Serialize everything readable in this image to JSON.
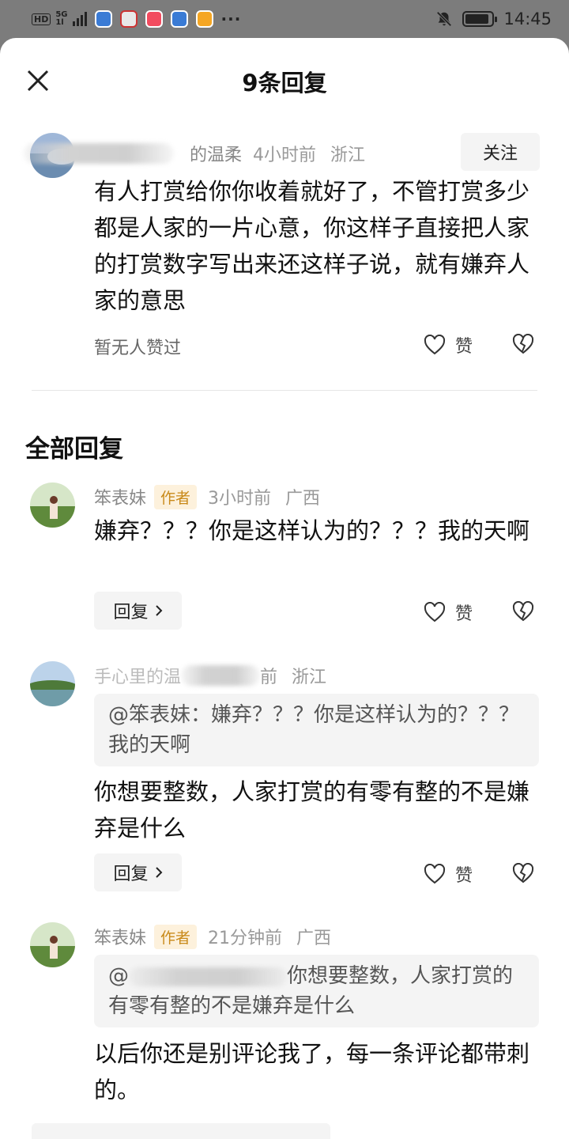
{
  "status_bar": {
    "network_badge": "HD",
    "network_type": "5G",
    "network_sub": "1l",
    "more": "···",
    "time": "14:45",
    "battery_level": 0.9
  },
  "header": {
    "title": "9条回复"
  },
  "main_comment": {
    "user_name_visible": "的温柔",
    "time": "4小时前",
    "location": "浙江",
    "follow_label": "关注",
    "text": "有人打赏给你你收着就好了，不管打赏多少都是人家的一片心意，你这样子直接把人家的打赏数字写出来还这样子说，就有嫌弃人家的意思",
    "no_likes": "暂无人赞过",
    "like_label": "赞"
  },
  "section_title": "全部回复",
  "replies": [
    {
      "name": "笨表妹",
      "badge": "作者",
      "time": "3小时前",
      "location": "广西",
      "text": "嫌弃？？？你是这样认为的？？？我的天啊",
      "reply_label": "回复",
      "like_label": "赞"
    },
    {
      "name_visible": "手心里的温",
      "time_visible": "前",
      "location": "浙江",
      "quote": "@笨表妹：嫌弃？？？你是这样认为的？？？我的天啊",
      "text": "你想要整数，人家打赏的有零有整的不是嫌弃是什么",
      "reply_label": "回复",
      "like_label": "赞"
    },
    {
      "name": "笨表妹",
      "badge": "作者",
      "time": "21分钟前",
      "location": "广西",
      "quote_prefix": "@",
      "quote_visible": "你想要整数，人家打赏的有零有整的不是嫌弃是什么",
      "text": "以后你还是别评论我了，每一条评论都带刺的。"
    }
  ]
}
